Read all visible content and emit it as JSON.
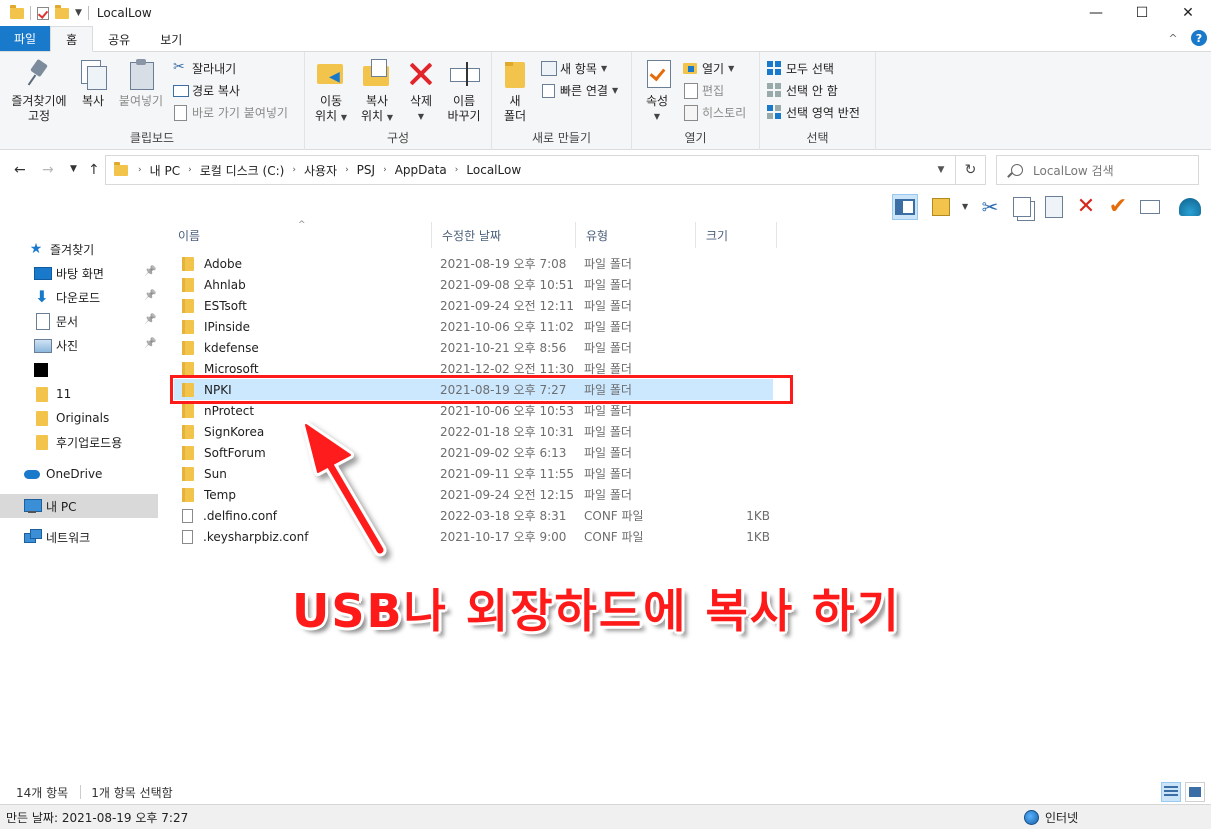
{
  "window": {
    "title": "LocalLow",
    "controls": {
      "minimize": "—",
      "maximize": "☐",
      "close": "✕"
    }
  },
  "ribbon_tabs": [
    {
      "label": "파일"
    },
    {
      "label": "홈"
    },
    {
      "label": "공유"
    },
    {
      "label": "보기"
    }
  ],
  "ribbon": {
    "clipboard": {
      "label": "클립보드",
      "pin_line1": "즐겨찾기에",
      "pin_line2": "고정",
      "copy": "복사",
      "paste": "붙여넣기",
      "cut": "잘라내기",
      "copy_path": "경로 복사",
      "paste_shortcut": "바로 가기 붙여넣기"
    },
    "organize": {
      "label": "구성",
      "move_line1": "이동",
      "move_line2": "위치",
      "copyto_line1": "복사",
      "copyto_line2": "위치",
      "delete": "삭제",
      "rename_line1": "이름",
      "rename_line2": "바꾸기"
    },
    "new": {
      "label": "새로 만들기",
      "newfolder_line1": "새",
      "newfolder_line2": "폴더",
      "new_item": "새 항목",
      "easy_access": "빠른 연결"
    },
    "open": {
      "label": "열기",
      "properties": "속성",
      "open": "열기",
      "edit": "편집",
      "history": "히스토리"
    },
    "select": {
      "label": "선택",
      "select_all": "모두 선택",
      "select_none": "선택 안 함",
      "invert": "선택 영역 반전"
    }
  },
  "address": {
    "breadcrumbs": [
      "내 PC",
      "로컬 디스크 (C:)",
      "사용자",
      "PSJ",
      "AppData",
      "LocalLow"
    ]
  },
  "search": {
    "placeholder": "LocalLow 검색"
  },
  "nav": [
    {
      "label": "즐겨찾기",
      "icon": "star-icon"
    },
    {
      "label": "바탕 화면",
      "icon": "desktop-icon",
      "pinned": true
    },
    {
      "label": "다운로드",
      "icon": "download-icon",
      "pinned": true
    },
    {
      "label": "문서",
      "icon": "document-icon",
      "pinned": true
    },
    {
      "label": "사진",
      "icon": "picture-icon",
      "pinned": true
    },
    {
      "label": "",
      "icon": "black-square-icon"
    },
    {
      "label": "11",
      "icon": "folder-icon"
    },
    {
      "label": "Originals",
      "icon": "folder-icon"
    },
    {
      "label": "후기업로드용",
      "icon": "folder-icon"
    },
    {
      "label": "OneDrive",
      "icon": "onedrive-icon"
    },
    {
      "label": "내 PC",
      "icon": "pc-icon",
      "selected": true
    },
    {
      "label": "네트워크",
      "icon": "network-icon"
    }
  ],
  "columns": {
    "name": "이름",
    "modified": "수정한 날짜",
    "type": "유형",
    "size": "크기"
  },
  "files": [
    {
      "name": "Adobe",
      "modified": "2021-08-19 오후 7:08",
      "type": "파일 폴더",
      "size": "",
      "kind": "folder"
    },
    {
      "name": "Ahnlab",
      "modified": "2021-09-08 오후 10:51",
      "type": "파일 폴더",
      "size": "",
      "kind": "folder"
    },
    {
      "name": "ESTsoft",
      "modified": "2021-09-24 오전 12:11",
      "type": "파일 폴더",
      "size": "",
      "kind": "folder"
    },
    {
      "name": "IPinside",
      "modified": "2021-10-06 오후 11:02",
      "type": "파일 폴더",
      "size": "",
      "kind": "folder"
    },
    {
      "name": "kdefense",
      "modified": "2021-10-21 오후 8:56",
      "type": "파일 폴더",
      "size": "",
      "kind": "folder"
    },
    {
      "name": "Microsoft",
      "modified": "2021-12-02 오전 11:30",
      "type": "파일 폴더",
      "size": "",
      "kind": "folder"
    },
    {
      "name": "NPKI",
      "modified": "2021-08-19 오후 7:27",
      "type": "파일 폴더",
      "size": "",
      "kind": "folder",
      "selected": true
    },
    {
      "name": "nProtect",
      "modified": "2021-10-06 오후 10:53",
      "type": "파일 폴더",
      "size": "",
      "kind": "folder"
    },
    {
      "name": "SignKorea",
      "modified": "2022-01-18 오후 10:31",
      "type": "파일 폴더",
      "size": "",
      "kind": "folder"
    },
    {
      "name": "SoftForum",
      "modified": "2021-09-02 오후 6:13",
      "type": "파일 폴더",
      "size": "",
      "kind": "folder"
    },
    {
      "name": "Sun",
      "modified": "2021-09-11 오후 11:55",
      "type": "파일 폴더",
      "size": "",
      "kind": "folder"
    },
    {
      "name": "Temp",
      "modified": "2021-09-24 오전 12:15",
      "type": "파일 폴더",
      "size": "",
      "kind": "folder"
    },
    {
      "name": ".delfino.conf",
      "modified": "2022-03-18 오후 8:31",
      "type": "CONF 파일",
      "size": "1KB",
      "kind": "file"
    },
    {
      "name": ".keysharpbiz.conf",
      "modified": "2021-10-17 오후 9:00",
      "type": "CONF 파일",
      "size": "1KB",
      "kind": "file"
    }
  ],
  "annotation": {
    "text": "USB나 외장하드에 복사 하기",
    "color": "#ff1a1a"
  },
  "status": {
    "count": "14개 항목",
    "selected": "1개 항목 선택함"
  },
  "bottom": {
    "details": "만든 날짜: 2021-08-19 오후 7:27",
    "zone": "인터넷"
  },
  "colors": {
    "accent": "#1979ca",
    "selection": "#cce8ff",
    "folder": "#f3c44b"
  }
}
